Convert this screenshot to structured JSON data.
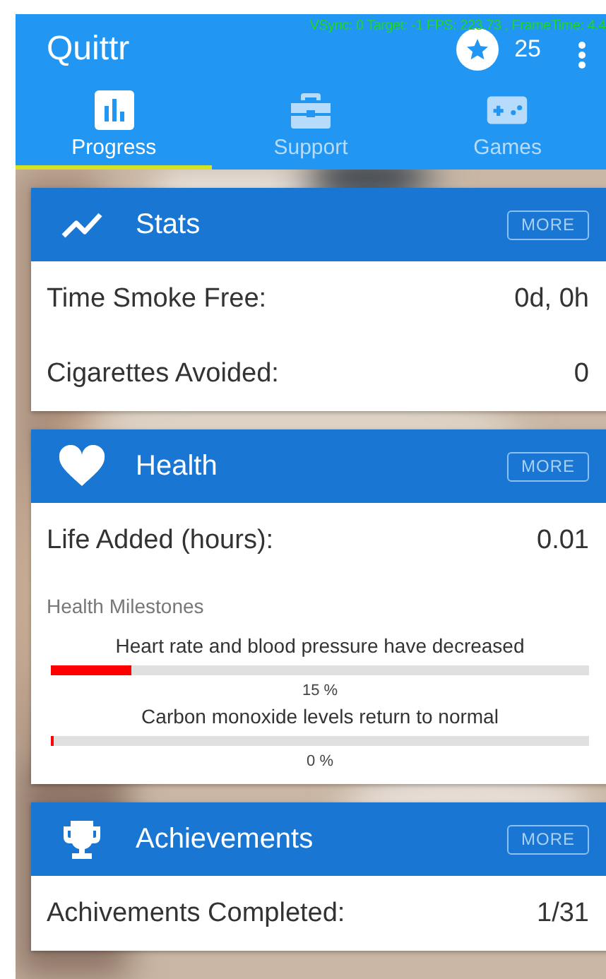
{
  "debug_overlay": "VSync: 0 Target: -1 FPS: 223.73 , FrameTime: 4.4",
  "app_bar": {
    "title": "Quittr",
    "points": "25"
  },
  "tabs": [
    {
      "label": "Progress",
      "selected": true
    },
    {
      "label": "Support",
      "selected": false
    },
    {
      "label": "Games",
      "selected": false
    }
  ],
  "cards": [
    {
      "title": "Stats",
      "button": "MORE",
      "rows": [
        {
          "label": "Time Smoke Free:",
          "value": "0d, 0h"
        },
        {
          "label": "Cigarettes Avoided:",
          "value": "0"
        }
      ]
    },
    {
      "title": "Health",
      "button": "MORE",
      "rows": [
        {
          "label": "Life Added (hours):",
          "value": "0.01"
        }
      ],
      "milestones_heading": "Health Milestones",
      "milestones": [
        {
          "name": "Heart rate and blood pressure have decreased",
          "level": 0.15,
          "reading": "15 %"
        },
        {
          "name": "Carbon monoxide levels return to normal",
          "level": 0,
          "reading": "0 %"
        }
      ]
    },
    {
      "title": "Achievements",
      "button": "MORE",
      "rows": [
        {
          "label": "Achivements Completed:",
          "value": "1/31"
        }
      ]
    }
  ]
}
